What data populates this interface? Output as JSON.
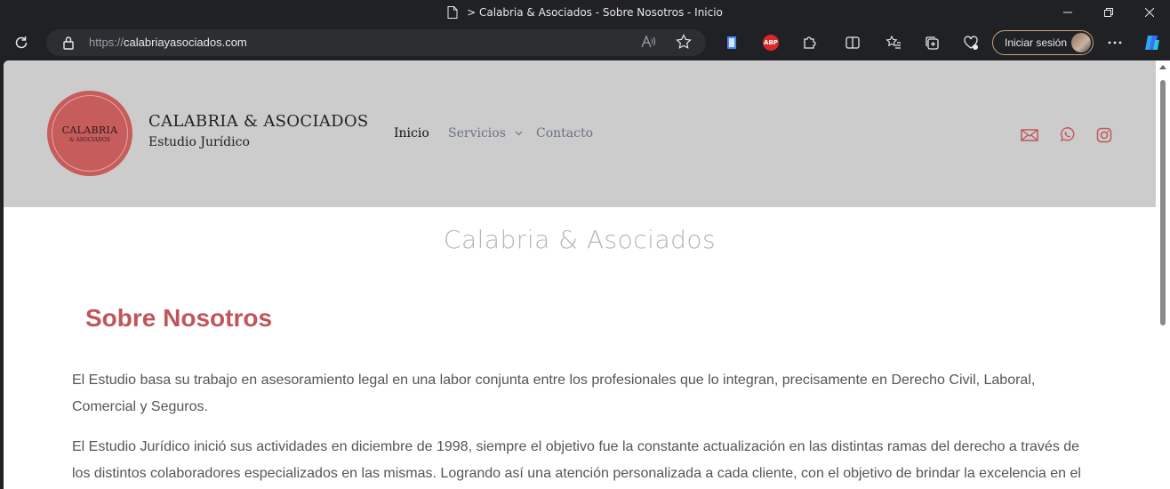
{
  "browser": {
    "window_title": "> Calabria & Asociados - Sobre Nosotros - Inicio",
    "url_prefix": "https://",
    "url_host": "calabriayasociados.com",
    "signin_label": "Iniciar sesión"
  },
  "site": {
    "logo_line1": "CALABRIA",
    "logo_line2": "& ASOCIADOS",
    "brand_name": "CALABRIA & ASOCIADOS",
    "brand_sub": "Estudio Jurídico",
    "nav": {
      "inicio": "Inicio",
      "servicios": "Servicios",
      "contacto": "Contacto"
    },
    "social_icons": [
      "mail-icon",
      "whatsapp-icon",
      "instagram-icon"
    ],
    "accent_color": "#c0565a",
    "header_bg": "#cccccc"
  },
  "content": {
    "hero_title": "Calabria & Asociados",
    "section_title": "Sobre Nosotros",
    "paragraph1": "El Estudio basa su trabajo en asesoramiento legal en una labor conjunta entre los profesionales que lo integran, precisamente en Derecho Civil, Laboral, Comercial y Seguros.",
    "paragraph2": "El Estudio Jurídico inició sus actividades en diciembre de 1998, siempre el objetivo fue la constante actualización en las distintas ramas del derecho a través de los distintos colaboradores especializados en las mismas. Logrando así una atención personalizada a cada cliente, con el objetivo de brindar la excelencia en el"
  }
}
